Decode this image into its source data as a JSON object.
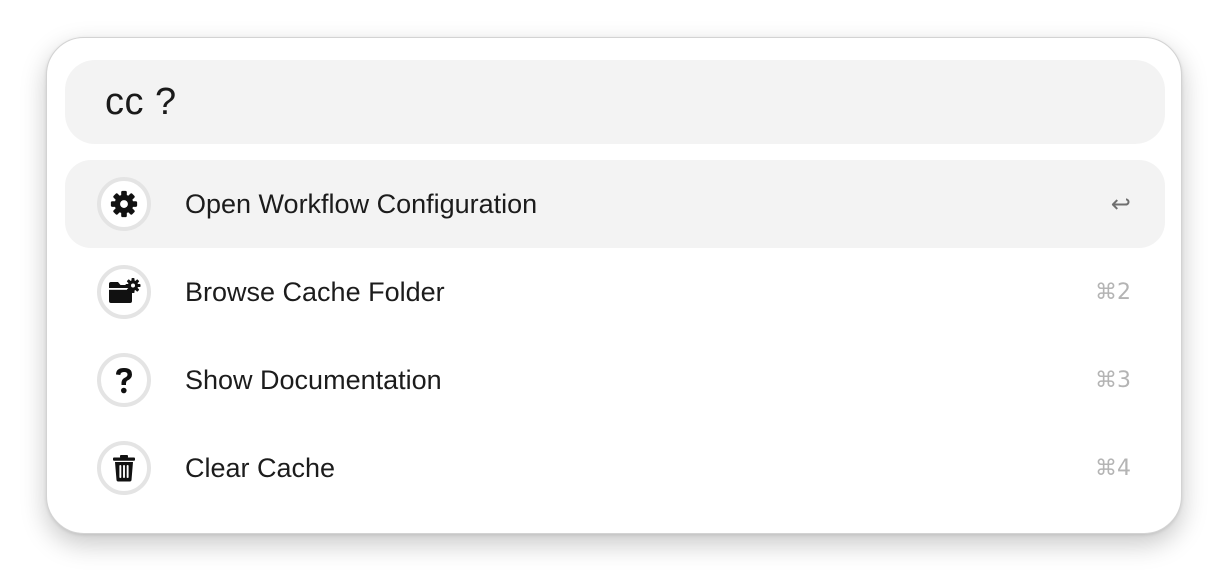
{
  "search": {
    "query": "cc ?"
  },
  "results": [
    {
      "label": "Open Workflow Configuration",
      "shortcut": "↩",
      "icon": "gear-icon",
      "selected": true
    },
    {
      "label": "Browse Cache Folder",
      "shortcut": "⌘2",
      "icon": "folder-gear-icon",
      "selected": false
    },
    {
      "label": "Show Documentation",
      "shortcut": "⌘3",
      "icon": "question-mark-icon",
      "selected": false
    },
    {
      "label": "Clear Cache",
      "shortcut": "⌘4",
      "icon": "trash-icon",
      "selected": false
    }
  ]
}
